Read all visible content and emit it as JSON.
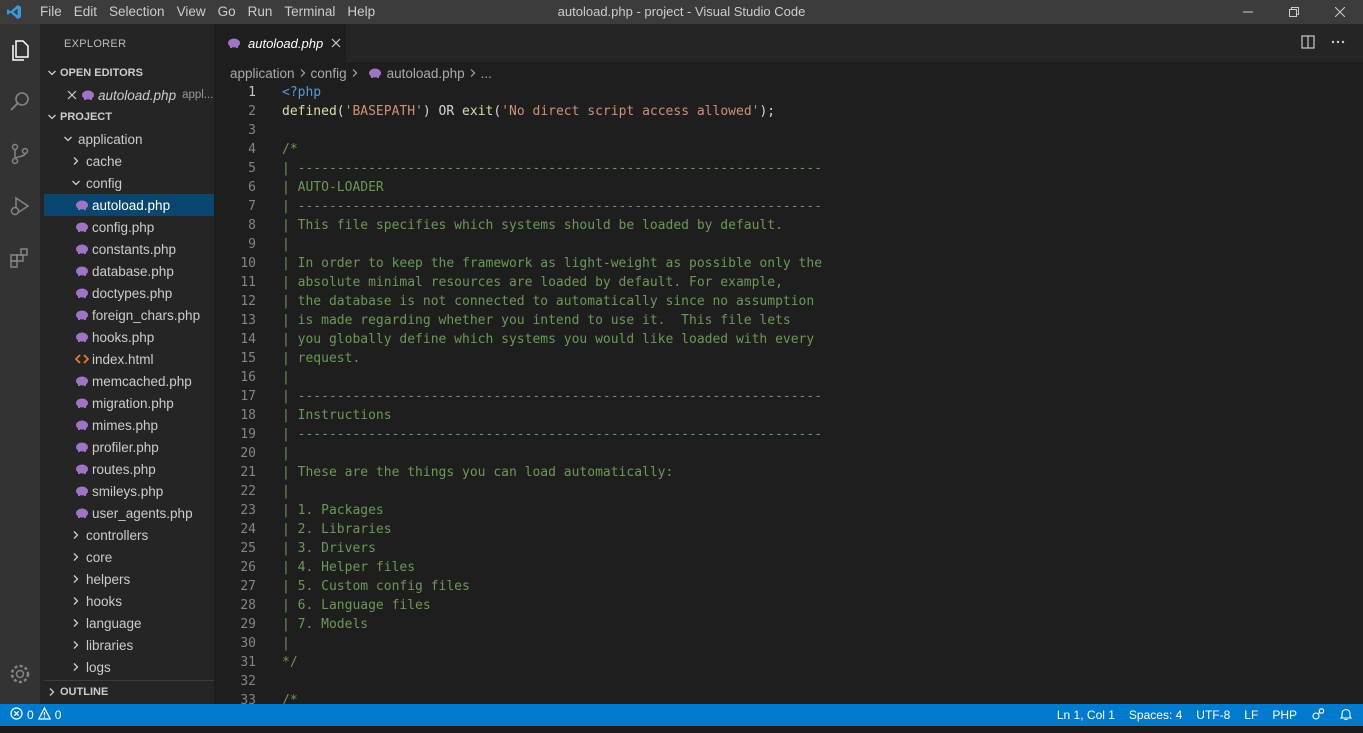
{
  "window": {
    "title": "autoload.php - project - Visual Studio Code",
    "menu": [
      "File",
      "Edit",
      "Selection",
      "View",
      "Go",
      "Run",
      "Terminal",
      "Help"
    ]
  },
  "sidebar": {
    "title": "EXPLORER",
    "open_editors_label": "OPEN EDITORS",
    "open_editor": {
      "name": "autoload.php",
      "path": "appl..."
    },
    "project_label": "PROJECT",
    "outline_label": "OUTLINE",
    "tree": [
      {
        "label": "application",
        "kind": "folder",
        "expanded": true,
        "depth": 0
      },
      {
        "label": "cache",
        "kind": "folder",
        "expanded": false,
        "depth": 1
      },
      {
        "label": "config",
        "kind": "folder",
        "expanded": true,
        "depth": 1
      },
      {
        "label": "autoload.php",
        "kind": "php",
        "depth": 2,
        "selected": true
      },
      {
        "label": "config.php",
        "kind": "php",
        "depth": 2
      },
      {
        "label": "constants.php",
        "kind": "php",
        "depth": 2
      },
      {
        "label": "database.php",
        "kind": "php",
        "depth": 2
      },
      {
        "label": "doctypes.php",
        "kind": "php",
        "depth": 2
      },
      {
        "label": "foreign_chars.php",
        "kind": "php",
        "depth": 2
      },
      {
        "label": "hooks.php",
        "kind": "php",
        "depth": 2
      },
      {
        "label": "index.html",
        "kind": "html",
        "depth": 2
      },
      {
        "label": "memcached.php",
        "kind": "php",
        "depth": 2
      },
      {
        "label": "migration.php",
        "kind": "php",
        "depth": 2
      },
      {
        "label": "mimes.php",
        "kind": "php",
        "depth": 2
      },
      {
        "label": "profiler.php",
        "kind": "php",
        "depth": 2
      },
      {
        "label": "routes.php",
        "kind": "php",
        "depth": 2
      },
      {
        "label": "smileys.php",
        "kind": "php",
        "depth": 2
      },
      {
        "label": "user_agents.php",
        "kind": "php",
        "depth": 2
      },
      {
        "label": "controllers",
        "kind": "folder",
        "expanded": false,
        "depth": 1
      },
      {
        "label": "core",
        "kind": "folder",
        "expanded": false,
        "depth": 1
      },
      {
        "label": "helpers",
        "kind": "folder",
        "expanded": false,
        "depth": 1
      },
      {
        "label": "hooks",
        "kind": "folder",
        "expanded": false,
        "depth": 1
      },
      {
        "label": "language",
        "kind": "folder",
        "expanded": false,
        "depth": 1
      },
      {
        "label": "libraries",
        "kind": "folder",
        "expanded": false,
        "depth": 1
      },
      {
        "label": "logs",
        "kind": "folder",
        "expanded": false,
        "depth": 1
      }
    ]
  },
  "editor": {
    "tab_label": "autoload.php",
    "breadcrumb": [
      "application",
      "config",
      "autoload.php",
      "..."
    ],
    "lines": [
      [
        [
          "tag",
          "<?php"
        ]
      ],
      [
        [
          "fn",
          "defined"
        ],
        [
          "plain",
          "("
        ],
        [
          "str",
          "'BASEPATH'"
        ],
        [
          "plain",
          ") OR "
        ],
        [
          "fn",
          "exit"
        ],
        [
          "plain",
          "("
        ],
        [
          "str",
          "'No direct script access allowed'"
        ],
        [
          "plain",
          ");"
        ]
      ],
      [],
      [
        [
          "cm",
          "/*"
        ]
      ],
      [
        [
          "cm",
          "| -------------------------------------------------------------------"
        ]
      ],
      [
        [
          "cm",
          "| AUTO-LOADER"
        ]
      ],
      [
        [
          "cm",
          "| -------------------------------------------------------------------"
        ]
      ],
      [
        [
          "cm",
          "| This file specifies which systems should be loaded by default."
        ]
      ],
      [
        [
          "cm",
          "|"
        ]
      ],
      [
        [
          "cm",
          "| In order to keep the framework as light-weight as possible only the"
        ]
      ],
      [
        [
          "cm",
          "| absolute minimal resources are loaded by default. For example,"
        ]
      ],
      [
        [
          "cm",
          "| the database is not connected to automatically since no assumption"
        ]
      ],
      [
        [
          "cm",
          "| is made regarding whether you intend to use it.  This file lets"
        ]
      ],
      [
        [
          "cm",
          "| you globally define which systems you would like loaded with every"
        ]
      ],
      [
        [
          "cm",
          "| request."
        ]
      ],
      [
        [
          "cm",
          "|"
        ]
      ],
      [
        [
          "cm",
          "| -------------------------------------------------------------------"
        ]
      ],
      [
        [
          "cm",
          "| Instructions"
        ]
      ],
      [
        [
          "cm",
          "| -------------------------------------------------------------------"
        ]
      ],
      [
        [
          "cm",
          "|"
        ]
      ],
      [
        [
          "cm",
          "| These are the things you can load automatically:"
        ]
      ],
      [
        [
          "cm",
          "|"
        ]
      ],
      [
        [
          "cm",
          "| 1. Packages"
        ]
      ],
      [
        [
          "cm",
          "| 2. Libraries"
        ]
      ],
      [
        [
          "cm",
          "| 3. Drivers"
        ]
      ],
      [
        [
          "cm",
          "| 4. Helper files"
        ]
      ],
      [
        [
          "cm",
          "| 5. Custom config files"
        ]
      ],
      [
        [
          "cm",
          "| 6. Language files"
        ]
      ],
      [
        [
          "cm",
          "| 7. Models"
        ]
      ],
      [
        [
          "cm",
          "|"
        ]
      ],
      [
        [
          "cm",
          "*/"
        ]
      ],
      [],
      [
        [
          "cm",
          "/*"
        ]
      ]
    ]
  },
  "statusbar": {
    "errors": "0",
    "warnings": "0",
    "position": "Ln 1, Col 1",
    "spaces": "Spaces: 4",
    "encoding": "UTF-8",
    "eol": "LF",
    "language": "PHP"
  },
  "colors": {
    "accent": "#007acc",
    "selection": "#094771",
    "php_icon": "#a074c4",
    "html_icon": "#e37933",
    "comment": "#6a9955",
    "string": "#ce9178"
  }
}
